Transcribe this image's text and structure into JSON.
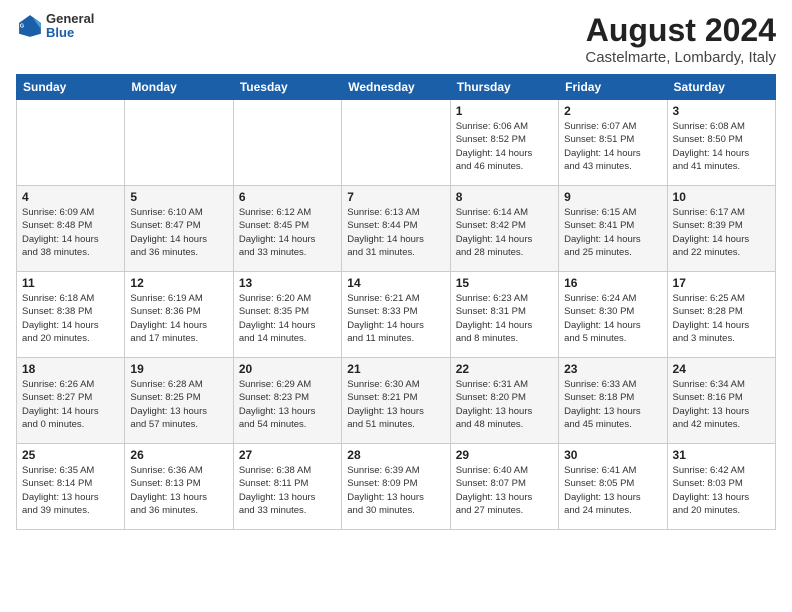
{
  "header": {
    "logo_general": "General",
    "logo_blue": "Blue",
    "title": "August 2024",
    "subtitle": "Castelmarte, Lombardy, Italy"
  },
  "weekdays": [
    "Sunday",
    "Monday",
    "Tuesday",
    "Wednesday",
    "Thursday",
    "Friday",
    "Saturday"
  ],
  "weeks": [
    [
      {
        "day": "",
        "info": ""
      },
      {
        "day": "",
        "info": ""
      },
      {
        "day": "",
        "info": ""
      },
      {
        "day": "",
        "info": ""
      },
      {
        "day": "1",
        "info": "Sunrise: 6:06 AM\nSunset: 8:52 PM\nDaylight: 14 hours\nand 46 minutes."
      },
      {
        "day": "2",
        "info": "Sunrise: 6:07 AM\nSunset: 8:51 PM\nDaylight: 14 hours\nand 43 minutes."
      },
      {
        "day": "3",
        "info": "Sunrise: 6:08 AM\nSunset: 8:50 PM\nDaylight: 14 hours\nand 41 minutes."
      }
    ],
    [
      {
        "day": "4",
        "info": "Sunrise: 6:09 AM\nSunset: 8:48 PM\nDaylight: 14 hours\nand 38 minutes."
      },
      {
        "day": "5",
        "info": "Sunrise: 6:10 AM\nSunset: 8:47 PM\nDaylight: 14 hours\nand 36 minutes."
      },
      {
        "day": "6",
        "info": "Sunrise: 6:12 AM\nSunset: 8:45 PM\nDaylight: 14 hours\nand 33 minutes."
      },
      {
        "day": "7",
        "info": "Sunrise: 6:13 AM\nSunset: 8:44 PM\nDaylight: 14 hours\nand 31 minutes."
      },
      {
        "day": "8",
        "info": "Sunrise: 6:14 AM\nSunset: 8:42 PM\nDaylight: 14 hours\nand 28 minutes."
      },
      {
        "day": "9",
        "info": "Sunrise: 6:15 AM\nSunset: 8:41 PM\nDaylight: 14 hours\nand 25 minutes."
      },
      {
        "day": "10",
        "info": "Sunrise: 6:17 AM\nSunset: 8:39 PM\nDaylight: 14 hours\nand 22 minutes."
      }
    ],
    [
      {
        "day": "11",
        "info": "Sunrise: 6:18 AM\nSunset: 8:38 PM\nDaylight: 14 hours\nand 20 minutes."
      },
      {
        "day": "12",
        "info": "Sunrise: 6:19 AM\nSunset: 8:36 PM\nDaylight: 14 hours\nand 17 minutes."
      },
      {
        "day": "13",
        "info": "Sunrise: 6:20 AM\nSunset: 8:35 PM\nDaylight: 14 hours\nand 14 minutes."
      },
      {
        "day": "14",
        "info": "Sunrise: 6:21 AM\nSunset: 8:33 PM\nDaylight: 14 hours\nand 11 minutes."
      },
      {
        "day": "15",
        "info": "Sunrise: 6:23 AM\nSunset: 8:31 PM\nDaylight: 14 hours\nand 8 minutes."
      },
      {
        "day": "16",
        "info": "Sunrise: 6:24 AM\nSunset: 8:30 PM\nDaylight: 14 hours\nand 5 minutes."
      },
      {
        "day": "17",
        "info": "Sunrise: 6:25 AM\nSunset: 8:28 PM\nDaylight: 14 hours\nand 3 minutes."
      }
    ],
    [
      {
        "day": "18",
        "info": "Sunrise: 6:26 AM\nSunset: 8:27 PM\nDaylight: 14 hours\nand 0 minutes."
      },
      {
        "day": "19",
        "info": "Sunrise: 6:28 AM\nSunset: 8:25 PM\nDaylight: 13 hours\nand 57 minutes."
      },
      {
        "day": "20",
        "info": "Sunrise: 6:29 AM\nSunset: 8:23 PM\nDaylight: 13 hours\nand 54 minutes."
      },
      {
        "day": "21",
        "info": "Sunrise: 6:30 AM\nSunset: 8:21 PM\nDaylight: 13 hours\nand 51 minutes."
      },
      {
        "day": "22",
        "info": "Sunrise: 6:31 AM\nSunset: 8:20 PM\nDaylight: 13 hours\nand 48 minutes."
      },
      {
        "day": "23",
        "info": "Sunrise: 6:33 AM\nSunset: 8:18 PM\nDaylight: 13 hours\nand 45 minutes."
      },
      {
        "day": "24",
        "info": "Sunrise: 6:34 AM\nSunset: 8:16 PM\nDaylight: 13 hours\nand 42 minutes."
      }
    ],
    [
      {
        "day": "25",
        "info": "Sunrise: 6:35 AM\nSunset: 8:14 PM\nDaylight: 13 hours\nand 39 minutes."
      },
      {
        "day": "26",
        "info": "Sunrise: 6:36 AM\nSunset: 8:13 PM\nDaylight: 13 hours\nand 36 minutes."
      },
      {
        "day": "27",
        "info": "Sunrise: 6:38 AM\nSunset: 8:11 PM\nDaylight: 13 hours\nand 33 minutes."
      },
      {
        "day": "28",
        "info": "Sunrise: 6:39 AM\nSunset: 8:09 PM\nDaylight: 13 hours\nand 30 minutes."
      },
      {
        "day": "29",
        "info": "Sunrise: 6:40 AM\nSunset: 8:07 PM\nDaylight: 13 hours\nand 27 minutes."
      },
      {
        "day": "30",
        "info": "Sunrise: 6:41 AM\nSunset: 8:05 PM\nDaylight: 13 hours\nand 24 minutes."
      },
      {
        "day": "31",
        "info": "Sunrise: 6:42 AM\nSunset: 8:03 PM\nDaylight: 13 hours\nand 20 minutes."
      }
    ]
  ]
}
